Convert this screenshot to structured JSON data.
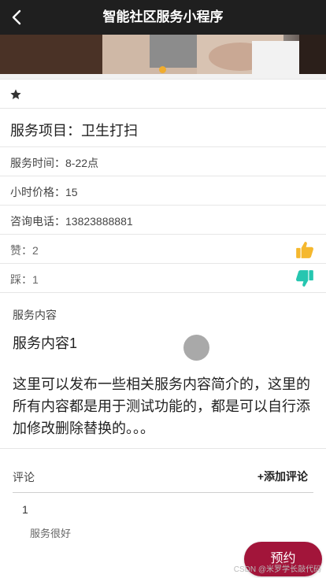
{
  "navbar": {
    "title": "智能社区服务小程序",
    "back_icon": "chevron-left-icon"
  },
  "banner": {
    "active_dot_color": "#f0ad2e"
  },
  "favorite": {
    "icon": "star-icon"
  },
  "service": {
    "item": "服务项目：卫生打扫",
    "time": "服务时间：8-22点",
    "price": "小时价格：15",
    "phone": "咨询电话：13823888881",
    "likes": "赞：2",
    "dislikes": "踩：1",
    "like_icon_color": "#f5b82e",
    "dislike_icon_color": "#26c6b0"
  },
  "content": {
    "label": "服务内容",
    "title": "服务内容1",
    "body": "这里可以发布一些相关服务内容简介的，这里的所有内容都是用于测试功能的，都是可以自行添加修改删除替换的。。。"
  },
  "comments": {
    "label": "评论",
    "add_label": "+添加评论",
    "items": [
      {
        "user": "1",
        "text": "服务很好"
      }
    ]
  },
  "book_button": {
    "label": "预约",
    "color": "#a2153a"
  },
  "watermark": "CSDN @米罗学长敲代码"
}
